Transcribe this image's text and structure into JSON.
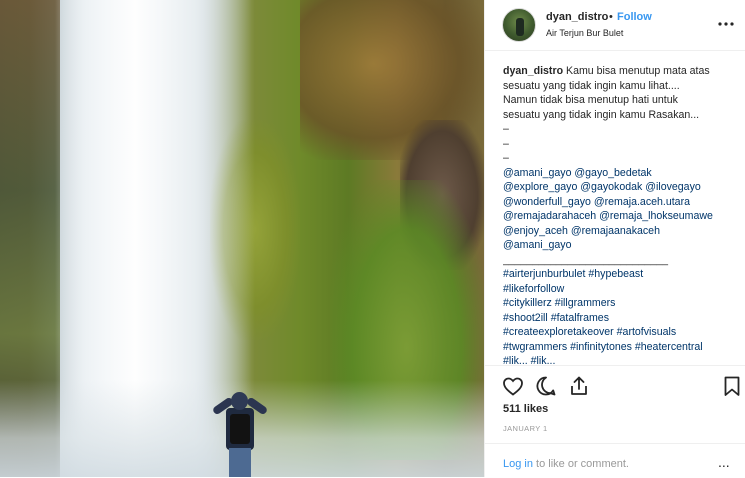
{
  "post": {
    "username": "dyan_distro",
    "separator": "•",
    "follow_label": "Follow",
    "location": "Air Terjun Bur Bulet",
    "more_icon": "more-horizontal-icon"
  },
  "caption": {
    "username": "dyan_distro",
    "lines": [
      "Kamu bisa menutup mata atas",
      "sesuatu yang tidak ingin kamu lihat....",
      "Namun tidak bisa menutup hati untuk",
      "sesuatu yang tidak ingin kamu Rasakan...",
      "–",
      "–",
      "–"
    ],
    "mentions": [
      "@amani_gayo @gayo_bedetak",
      "@explore_gayo @gayokodak @ilovegayo",
      "@wonderfull_gayo @remaja.aceh.utara",
      "@remajadarahaceh @remaja_lhokseumawe",
      "@enjoy_aceh @remajaanakaceh",
      "@amani_gayo"
    ],
    "divider": "____________________________",
    "hashtags": [
      "#airterjunburbulet #hypebeast",
      "#likeforfollow",
      "#citykillerz #illgrammers",
      "#shoot2ill #fatalframes",
      "#createexploretakeover #artofvisuals",
      "#twgrammers #infinitytones #heatercentral",
      "#lik... #lik..."
    ]
  },
  "actions": {
    "like_icon": "heart-icon",
    "comment_icon": "comment-icon",
    "share_icon": "share-icon",
    "save_icon": "bookmark-icon"
  },
  "likes": "511 likes",
  "date": "JANUARY 1",
  "footer": {
    "login_label": "Log in",
    "login_suffix": " to like or comment.",
    "ellipsis": "..."
  }
}
